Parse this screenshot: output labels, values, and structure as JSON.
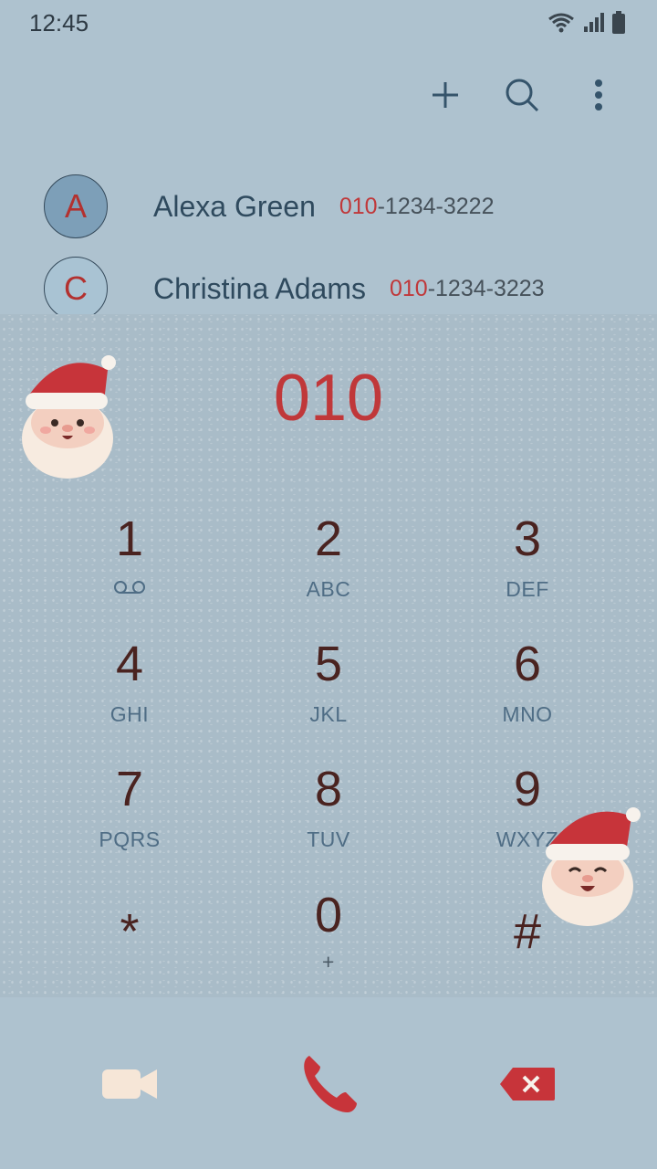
{
  "status_bar": {
    "time": "12:45"
  },
  "toolbar": {
    "add": "add-icon",
    "search": "search-icon",
    "more": "more-vert-icon"
  },
  "contacts": [
    {
      "initial": "A",
      "name": "Alexa Green",
      "phone_prefix": "010",
      "phone_rest": "-1234-3222",
      "avatar_color": "#7d9fb8"
    },
    {
      "initial": "C",
      "name": "Christina Adams",
      "phone_prefix": "010",
      "phone_rest": "-1234-3223",
      "avatar_color": "#a9c3d3"
    }
  ],
  "dialer": {
    "entered_number": "010",
    "keys": [
      {
        "digit": "1",
        "letters": ""
      },
      {
        "digit": "2",
        "letters": "ABC"
      },
      {
        "digit": "3",
        "letters": "DEF"
      },
      {
        "digit": "4",
        "letters": "GHI"
      },
      {
        "digit": "5",
        "letters": "JKL"
      },
      {
        "digit": "6",
        "letters": "MNO"
      },
      {
        "digit": "7",
        "letters": "PQRS"
      },
      {
        "digit": "8",
        "letters": "TUV"
      },
      {
        "digit": "9",
        "letters": "WXYZ"
      },
      {
        "digit": "*",
        "letters": ""
      },
      {
        "digit": "0",
        "letters": "+"
      },
      {
        "digit": "#",
        "letters": ""
      }
    ]
  },
  "actions": {
    "video": "video-call-icon",
    "call": "phone-call-icon",
    "backspace": "backspace-icon"
  },
  "colors": {
    "accent_red": "#c0383a",
    "digit_brown": "#4a2320",
    "letter_blue": "#4f6d85",
    "background": "#aec2cf"
  }
}
